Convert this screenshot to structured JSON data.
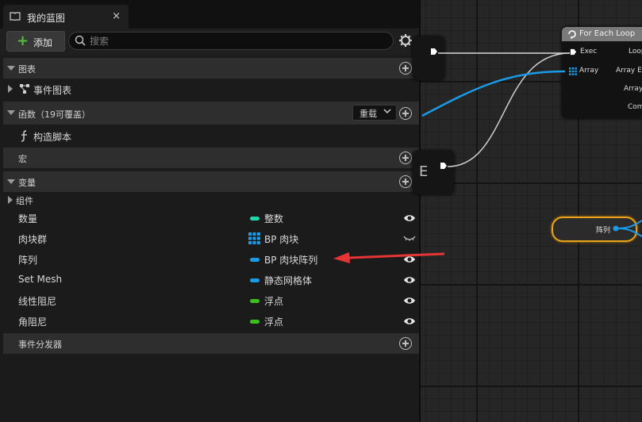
{
  "tab": {
    "title": "我的蓝图",
    "close": "×"
  },
  "toolbar": {
    "add_label": "添加",
    "search_placeholder": "搜索"
  },
  "sections": {
    "graphs": "图表",
    "functions": "函数（19可覆盖）",
    "functions_override": "重载",
    "macros": "宏",
    "variables": "变量",
    "dispatchers": "事件分发器"
  },
  "items": {
    "event_graph": "事件图表",
    "construction_script": "构造脚本",
    "components": "组件"
  },
  "variables": [
    {
      "name": "数量",
      "type": "整数",
      "color": "#1fd6a8",
      "eye": "open"
    },
    {
      "name": "肉块群",
      "type": "BP 肉块",
      "color": "#1a9be8",
      "eye": "closed"
    },
    {
      "name": "阵列",
      "type": "BP 肉块阵列",
      "color": "#1a9be8",
      "eye": "open"
    },
    {
      "name": "Set Mesh",
      "type": "静态网格体",
      "color": "#1a9be8",
      "eye": "open"
    },
    {
      "name": "线性阻尼",
      "type": "浮点",
      "color": "#39c01a",
      "eye": "open"
    },
    {
      "name": "角阻尼",
      "type": "浮点",
      "color": "#39c01a",
      "eye": "open"
    }
  ],
  "graph": {
    "foreach_title": "For Each Loop",
    "pin_exec": "Exec",
    "pin_array": "Array",
    "pin_loop": "Loop",
    "pin_array_element": "Array Ele",
    "pin_array_index": "Array",
    "pin_completed": "Com",
    "array_node_label": "阵列",
    "partial_node_letter": "E"
  },
  "colors": {
    "accent_green": "#4fbf3a",
    "pin_blue": "#1a9be8",
    "annotation_red": "#e53535",
    "selection_orange": "#e8a21c"
  }
}
